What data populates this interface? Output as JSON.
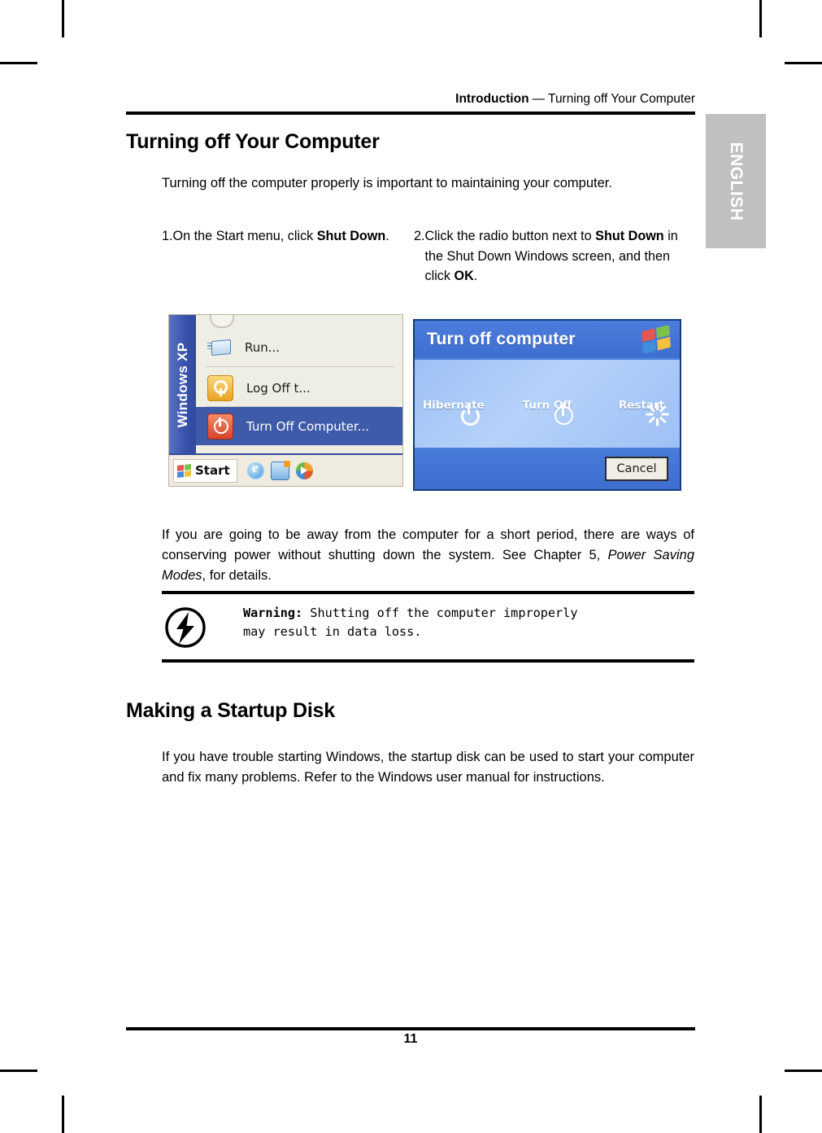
{
  "header": {
    "section": "Introduction",
    "dash": "—",
    "topic": "Turning off Your Computer"
  },
  "side_tab": {
    "label": "ENGLISH",
    "bg_color": "#c0c0c0",
    "text_color": "#ffffff"
  },
  "sections": {
    "turning_off": {
      "heading": "Turning off Your Computer",
      "intro": "Turning off the computer properly is important to maintaining your computer.",
      "steps": [
        {
          "number": "1.",
          "text_before": "On the Start menu, click ",
          "bold": "Shut Down",
          "text_after": "."
        },
        {
          "number": "2.",
          "text_before": "Click the radio button next to ",
          "bold": "Shut Down",
          "text_mid": " in the Shut Down Windows screen, and then click ",
          "bold2": "OK",
          "text_after": "."
        }
      ],
      "after_images_para_1": "If you are going to be away from the computer for a short period, there are ways of conserving power without shutting down the system. See Chapter 5, ",
      "after_images_italic": "Power Saving Modes",
      "after_images_para_2": ", for details."
    },
    "startup_disk": {
      "heading": "Making a Startup Disk",
      "body": "If you have trouble starting Windows, the startup disk can be used to start your computer and fix many problems. Refer to the Windows user manual for instructions."
    }
  },
  "warning": {
    "icon": "lightning-bolt-warning-icon",
    "label": "Warning:",
    "line1": " Shutting off the computer improperly",
    "line2": "may result in data loss."
  },
  "figure_start_menu": {
    "brand": "Windows XP",
    "items": [
      {
        "icon": "run-icon",
        "label": "Run...",
        "highlighted": false
      },
      {
        "icon": "key-icon",
        "label": "Log Off t...",
        "highlighted": false
      },
      {
        "icon": "power-icon",
        "label": "Turn Off Computer...",
        "highlighted": true
      }
    ],
    "taskbar": {
      "start_label": "Start",
      "quick_launch": [
        "internet-explorer-icon",
        "show-desktop-icon",
        "windows-media-player-icon"
      ]
    },
    "highlight_color": "#3e5ba9"
  },
  "figure_turn_off_dialog": {
    "title": "Turn off computer",
    "logo": "windows-flag-logo",
    "options": [
      {
        "icon": "hibernate-icon",
        "label": "Hibernate",
        "color": "#f3c43c"
      },
      {
        "icon": "turn-off-icon",
        "label": "Turn Off",
        "color": "#e0513a"
      },
      {
        "icon": "restart-icon",
        "label": "Restart",
        "color": "#3f9b3f"
      }
    ],
    "cancel_label": "Cancel",
    "titlebar_color": "#4c7ddd",
    "panel_color": "#9dc0f4"
  },
  "footer": {
    "page_number": "11"
  }
}
